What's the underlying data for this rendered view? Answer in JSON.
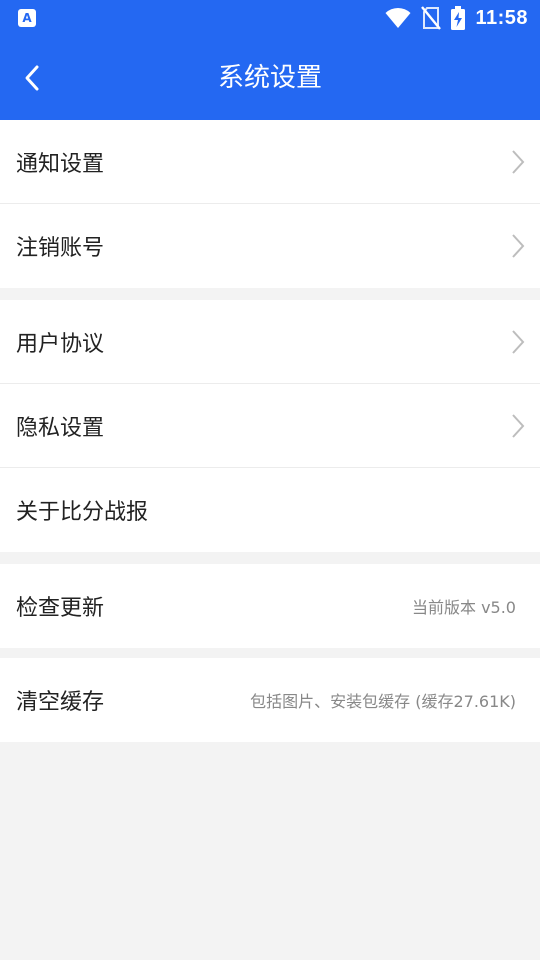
{
  "status_bar": {
    "time": "11:58",
    "app_icon": "app-notification-icon",
    "app_icon_glyph": "A",
    "icons": [
      "wifi-icon",
      "no-sim-icon",
      "battery-charging-icon"
    ]
  },
  "nav": {
    "title": "系统设置",
    "back_icon": "back-arrow-icon",
    "color": "#2468f2"
  },
  "settings": {
    "notification": {
      "label": "通知设置"
    },
    "cancel_account": {
      "label": "注销账号"
    },
    "user_agreement": {
      "label": "用户协议"
    },
    "privacy": {
      "label": "隐私设置"
    },
    "about": {
      "label": "关于比分战报"
    },
    "check_update": {
      "label": "检查更新",
      "value": "当前版本 v5.0"
    },
    "clear_cache": {
      "label": "清空缓存",
      "value": "包括图片、安装包缓存 (缓存27.61K)"
    }
  }
}
